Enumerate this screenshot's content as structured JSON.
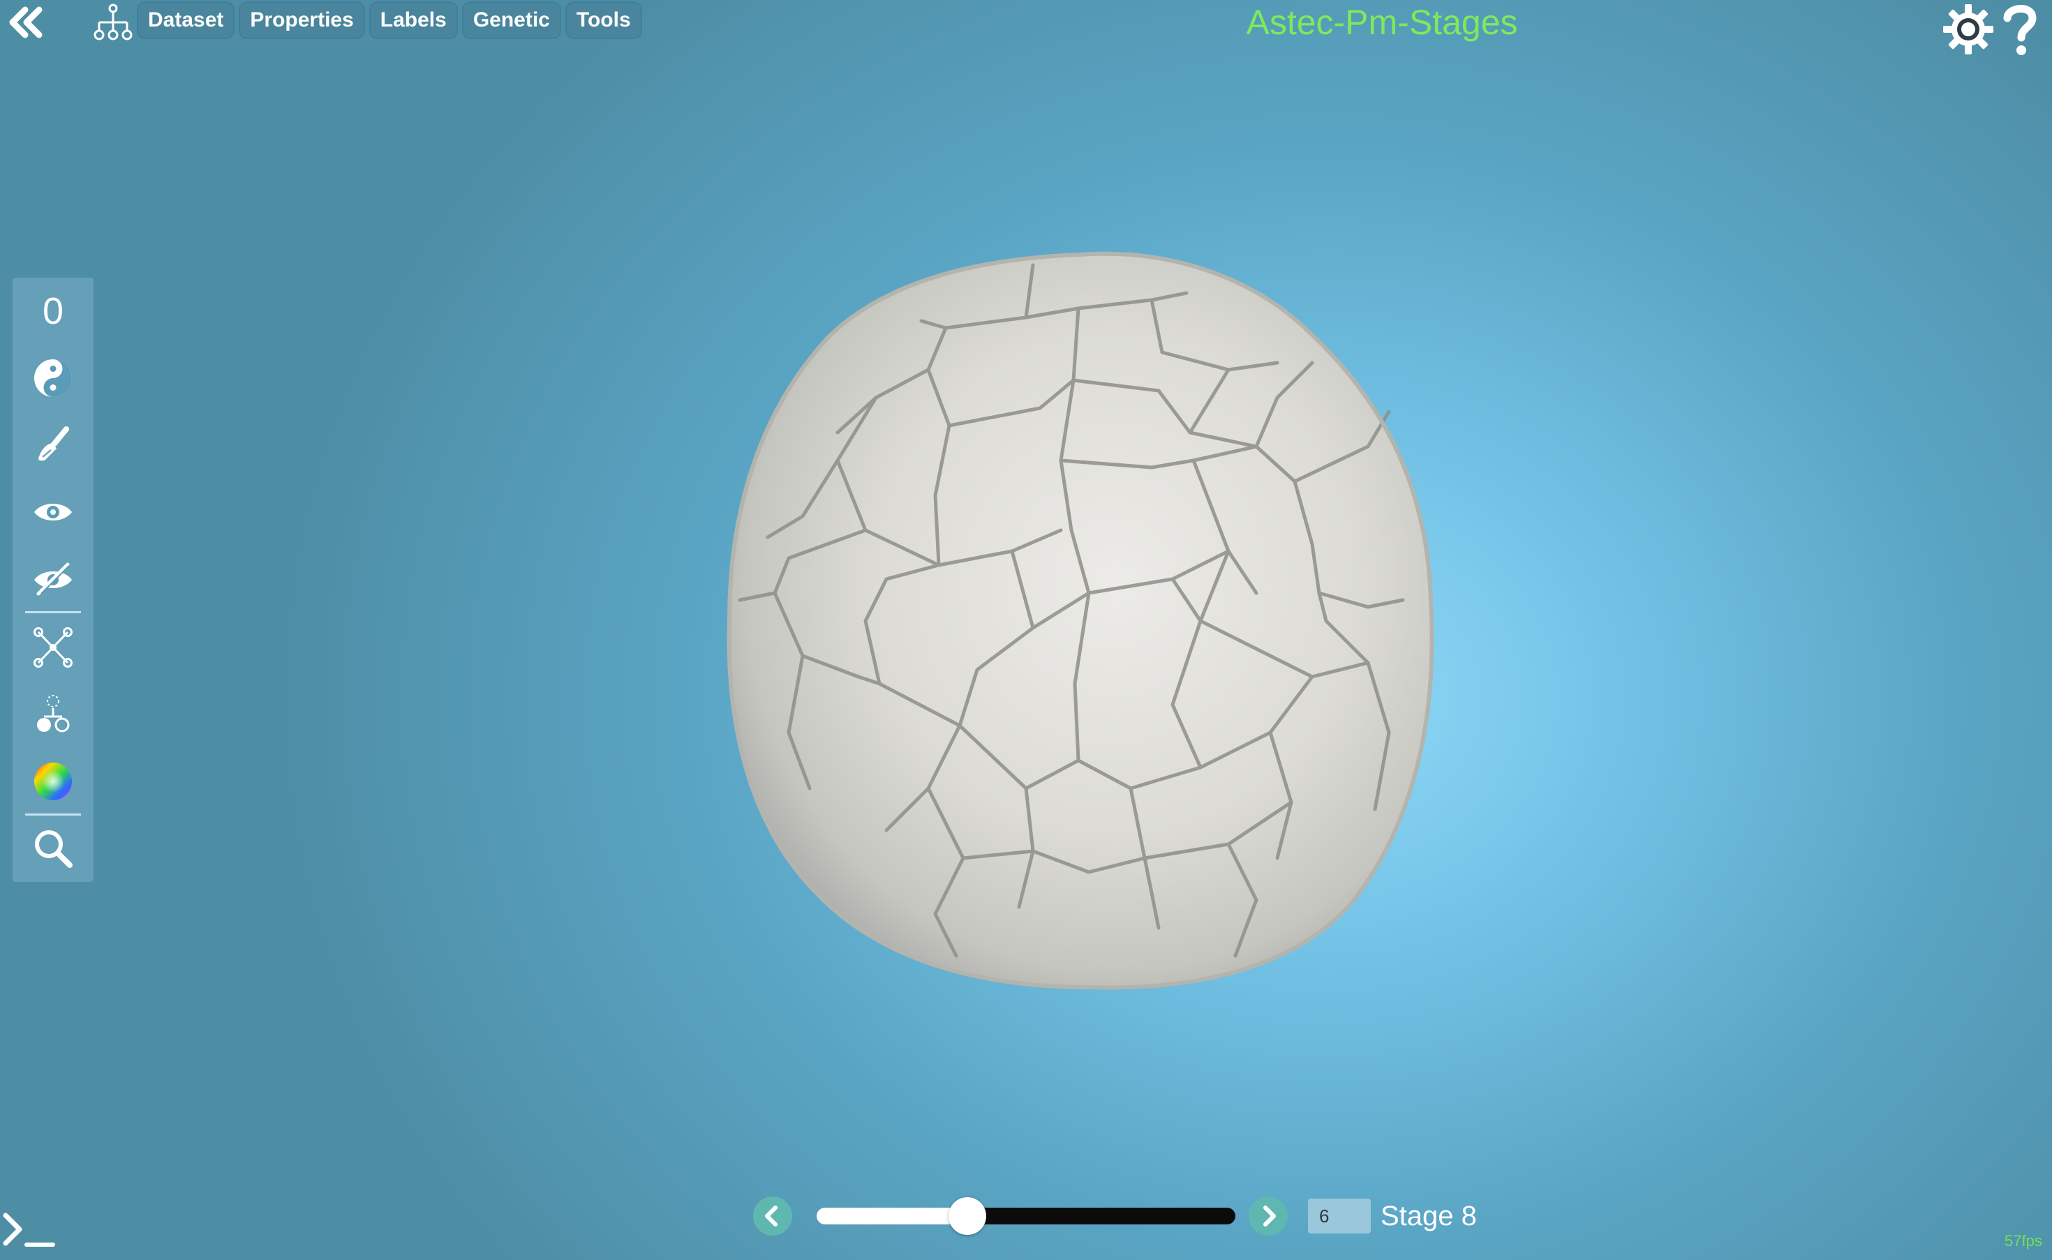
{
  "header": {
    "title": "Astec-Pm-Stages",
    "title_color": "#7dea5c",
    "icons": [
      "back-icon",
      "lineage-tree-icon",
      "gear-icon",
      "help-icon"
    ],
    "menu": [
      {
        "label": "Dataset"
      },
      {
        "label": "Properties"
      },
      {
        "label": "Labels"
      },
      {
        "label": "Genetic"
      },
      {
        "label": "Tools"
      }
    ]
  },
  "toolbar": {
    "counter": "0",
    "tools": [
      "yin-yang-icon",
      "brush-icon",
      "eye-icon",
      "eye-slash-icon",
      "network-icon",
      "cell-split-icon",
      "color-wheel-icon",
      "search-icon"
    ]
  },
  "timeline": {
    "time_value": "6",
    "stage_label": "Stage 8",
    "slider_fraction": 0.36,
    "controls": [
      "previous-icon",
      "next-icon"
    ]
  },
  "status": {
    "fps": "57fps",
    "console_icon": "terminal-icon"
  },
  "colors": {
    "accent": "#5fb8b0",
    "cell_fill": "#d7d7d2",
    "background_center": "#8fd9f8",
    "background_edge": "#4e8ea5"
  }
}
